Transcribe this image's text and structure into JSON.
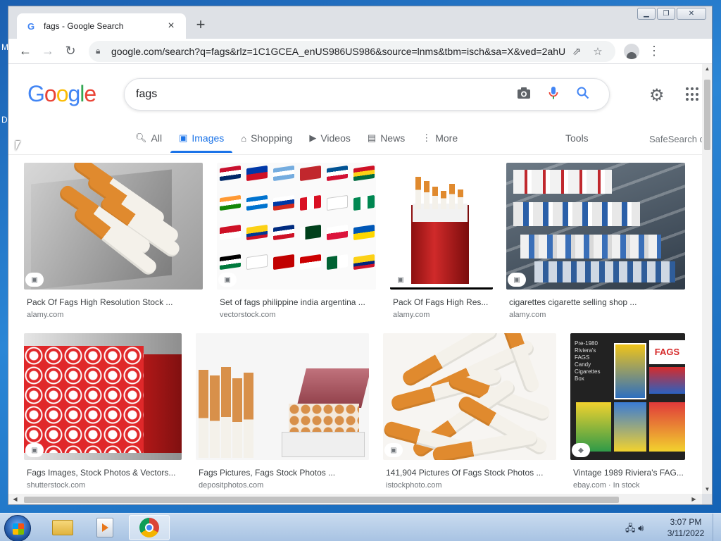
{
  "desktop": {
    "letters": [
      "M",
      "D"
    ]
  },
  "browser": {
    "tab_title": "fags - Google Search",
    "tab_favicon": "G",
    "url": "google.com/search?q=fags&rlz=1C1GCEA_enUS986US986&source=lnms&tbm=isch&sa=X&ved=2ahUKEwiu7K..."
  },
  "google": {
    "query": "fags",
    "tabs": [
      {
        "label": "All",
        "icon": "search-icon"
      },
      {
        "label": "Images",
        "icon": "image-icon"
      },
      {
        "label": "Shopping",
        "icon": "tag-icon"
      },
      {
        "label": "Videos",
        "icon": "play-icon"
      },
      {
        "label": "News",
        "icon": "news-icon"
      },
      {
        "label": "More",
        "icon": "dots-icon"
      }
    ],
    "tools_label": "Tools",
    "safesearch_label": "SafeSearch o"
  },
  "results": [
    {
      "title": "Pack Of Fags High Resolution Stock ...",
      "source": "alamy.com"
    },
    {
      "title": "Set of fags philippine india argentina ...",
      "source": "vectorstock.com"
    },
    {
      "title": "Pack Of Fags High Res...",
      "source": "alamy.com"
    },
    {
      "title": "cigarettes cigarette selling shop ...",
      "source": "alamy.com"
    },
    {
      "title": "Fags Images, Stock Photos & Vectors...",
      "source": "shutterstock.com"
    },
    {
      "title": "Fags Pictures, Fags Stock Photos ...",
      "source": "depositphotos.com"
    },
    {
      "title": "141,904 Pictures Of Fags Stock Photos ...",
      "source": "istockphoto.com"
    },
    {
      "title": "Vintage 1989 Riviera's FAG...",
      "source": "ebay.com · In stock"
    }
  ],
  "taskbar": {
    "time": "3:07 PM",
    "date": "3/11/2022"
  }
}
